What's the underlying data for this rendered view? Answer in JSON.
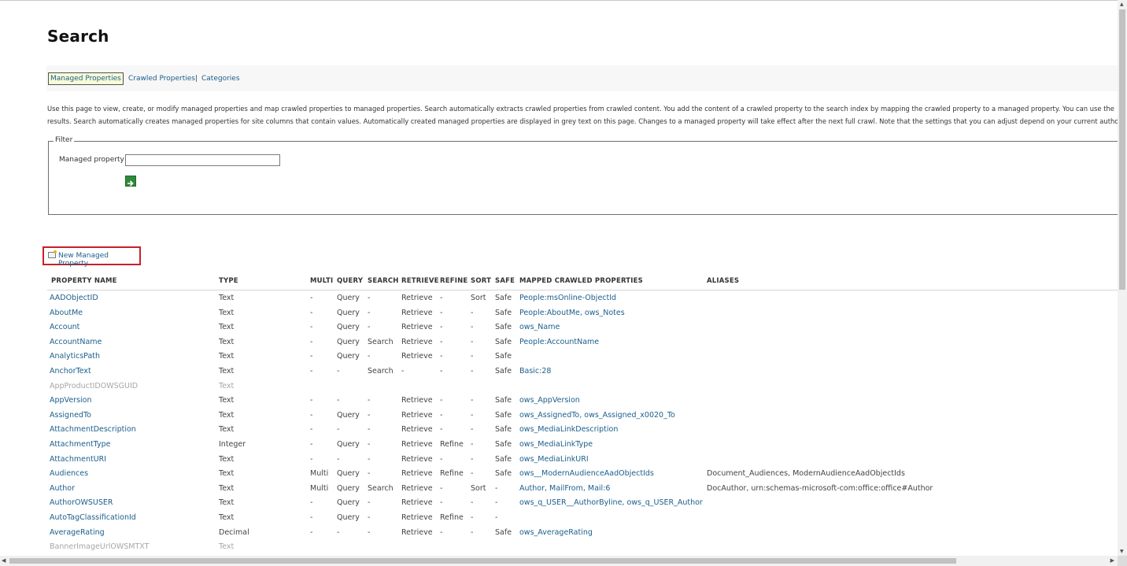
{
  "page": {
    "title": "Search"
  },
  "tabs": {
    "items": [
      {
        "label": "Managed Properties",
        "active": true
      },
      {
        "label": "Crawled Properties",
        "active": false
      },
      {
        "label": "Categories",
        "active": false
      }
    ],
    "separator": "|"
  },
  "description": {
    "line1": "Use this page to view, create, or modify managed properties and map crawled properties to managed properties. Search automatically extracts crawled properties from crawled content. You add the content of a crawled property to the search index by mapping the crawled property to a managed property. You can use the",
    "line2": "results. Search automatically creates managed properties for site columns that contain values. Automatically created managed properties are displayed in grey text on this page. Changes to a managed property will take effect after the next full crawl. Note that the settings that you can adjust depend on your current autho"
  },
  "filter": {
    "legend": "Filter",
    "field_label": "Managed property",
    "field_value": "",
    "go_icon": "arrow-right-icon"
  },
  "new_property": {
    "label": "New Managed Property",
    "icon": "new-item-icon"
  },
  "table": {
    "headers": [
      "PROPERTY NAME",
      "TYPE",
      "MULTI",
      "QUERY",
      "SEARCH",
      "RETRIEVE",
      "REFINE",
      "SORT",
      "SAFE",
      "MAPPED CRAWLED PROPERTIES",
      "ALIASES"
    ],
    "rows": [
      {
        "name": "AADObjectID",
        "type": "Text",
        "multi": "-",
        "query": "Query",
        "search": "-",
        "retrieve": "Retrieve",
        "refine": "-",
        "sort": "Sort",
        "safe": "Safe",
        "mapped": "People:msOnline-ObjectId",
        "aliases": "",
        "auto": false
      },
      {
        "name": "AboutMe",
        "type": "Text",
        "multi": "-",
        "query": "Query",
        "search": "-",
        "retrieve": "Retrieve",
        "refine": "-",
        "sort": "-",
        "safe": "Safe",
        "mapped": "People:AboutMe, ows_Notes",
        "aliases": "",
        "auto": false
      },
      {
        "name": "Account",
        "type": "Text",
        "multi": "-",
        "query": "Query",
        "search": "-",
        "retrieve": "Retrieve",
        "refine": "-",
        "sort": "-",
        "safe": "Safe",
        "mapped": "ows_Name",
        "aliases": "",
        "auto": false
      },
      {
        "name": "AccountName",
        "type": "Text",
        "multi": "-",
        "query": "Query",
        "search": "Search",
        "retrieve": "Retrieve",
        "refine": "-",
        "sort": "-",
        "safe": "Safe",
        "mapped": "People:AccountName",
        "aliases": "",
        "auto": false
      },
      {
        "name": "AnalyticsPath",
        "type": "Text",
        "multi": "-",
        "query": "Query",
        "search": "-",
        "retrieve": "Retrieve",
        "refine": "-",
        "sort": "-",
        "safe": "Safe",
        "mapped": "",
        "aliases": "",
        "auto": false
      },
      {
        "name": "AnchorText",
        "type": "Text",
        "multi": "-",
        "query": "-",
        "search": "Search",
        "retrieve": "-",
        "refine": "-",
        "sort": "-",
        "safe": "Safe",
        "mapped": "Basic:28",
        "aliases": "",
        "auto": false
      },
      {
        "name": "AppProductIDOWSGUID",
        "type": "Text",
        "multi": "",
        "query": "",
        "search": "",
        "retrieve": "",
        "refine": "",
        "sort": "",
        "safe": "",
        "mapped": "",
        "aliases": "",
        "auto": true
      },
      {
        "name": "AppVersion",
        "type": "Text",
        "multi": "-",
        "query": "-",
        "search": "-",
        "retrieve": "Retrieve",
        "refine": "-",
        "sort": "-",
        "safe": "Safe",
        "mapped": "ows_AppVersion",
        "aliases": "",
        "auto": false
      },
      {
        "name": "AssignedTo",
        "type": "Text",
        "multi": "-",
        "query": "Query",
        "search": "-",
        "retrieve": "Retrieve",
        "refine": "-",
        "sort": "-",
        "safe": "Safe",
        "mapped": "ows_AssignedTo, ows_Assigned_x0020_To",
        "aliases": "",
        "auto": false
      },
      {
        "name": "AttachmentDescription",
        "type": "Text",
        "multi": "-",
        "query": "-",
        "search": "-",
        "retrieve": "Retrieve",
        "refine": "-",
        "sort": "-",
        "safe": "Safe",
        "mapped": "ows_MediaLinkDescription",
        "aliases": "",
        "auto": false
      },
      {
        "name": "AttachmentType",
        "type": "Integer",
        "multi": "-",
        "query": "Query",
        "search": "-",
        "retrieve": "Retrieve",
        "refine": "Refine",
        "sort": "-",
        "safe": "Safe",
        "mapped": "ows_MediaLinkType",
        "aliases": "",
        "auto": false
      },
      {
        "name": "AttachmentURI",
        "type": "Text",
        "multi": "-",
        "query": "-",
        "search": "-",
        "retrieve": "Retrieve",
        "refine": "-",
        "sort": "-",
        "safe": "Safe",
        "mapped": "ows_MediaLinkURI",
        "aliases": "",
        "auto": false
      },
      {
        "name": "Audiences",
        "type": "Text",
        "multi": "Multi",
        "query": "Query",
        "search": "-",
        "retrieve": "Retrieve",
        "refine": "Refine",
        "sort": "-",
        "safe": "Safe",
        "mapped": "ows__ModernAudienceAadObjectIds",
        "aliases": "Document_Audiences, ModernAudienceAadObjectIds",
        "auto": false
      },
      {
        "name": "Author",
        "type": "Text",
        "multi": "Multi",
        "query": "Query",
        "search": "Search",
        "retrieve": "Retrieve",
        "refine": "-",
        "sort": "Sort",
        "safe": "-",
        "mapped": "Author, MailFrom, Mail:6",
        "aliases": "DocAuthor, urn:schemas-microsoft-com:office:office#Author",
        "auto": false
      },
      {
        "name": "AuthorOWSUSER",
        "type": "Text",
        "multi": "-",
        "query": "Query",
        "search": "-",
        "retrieve": "Retrieve",
        "refine": "-",
        "sort": "-",
        "safe": "-",
        "mapped": "ows_q_USER__AuthorByline, ows_q_USER_Author",
        "aliases": "",
        "auto": false
      },
      {
        "name": "AutoTagClassificationId",
        "type": "Text",
        "multi": "-",
        "query": "Query",
        "search": "-",
        "retrieve": "Retrieve",
        "refine": "Refine",
        "sort": "-",
        "safe": "-",
        "mapped": "",
        "aliases": "",
        "auto": false
      },
      {
        "name": "AverageRating",
        "type": "Decimal",
        "multi": "-",
        "query": "-",
        "search": "-",
        "retrieve": "Retrieve",
        "refine": "-",
        "sort": "-",
        "safe": "Safe",
        "mapped": "ows_AverageRating",
        "aliases": "",
        "auto": false
      },
      {
        "name": "BannerImageUrlOWSMTXT",
        "type": "Text",
        "multi": "",
        "query": "",
        "search": "",
        "retrieve": "",
        "refine": "",
        "sort": "",
        "safe": "",
        "mapped": "",
        "aliases": "",
        "auto": true
      }
    ]
  }
}
